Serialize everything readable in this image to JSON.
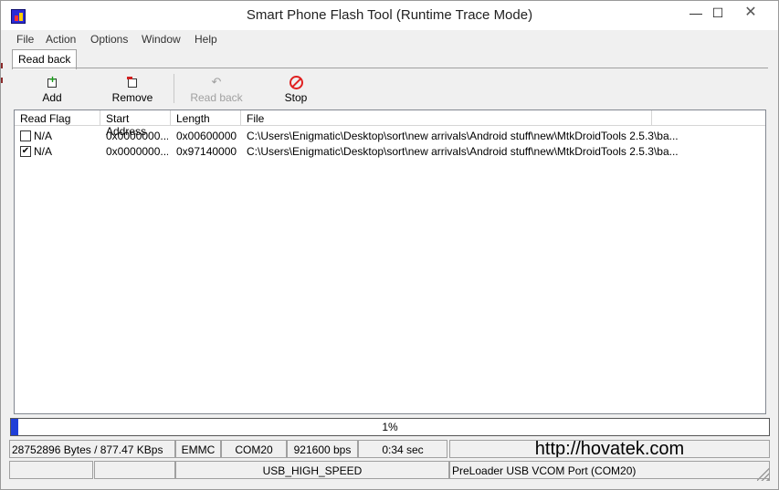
{
  "window": {
    "title": "Smart Phone Flash Tool (Runtime Trace Mode)",
    "controls": {
      "minimize": "—",
      "maximize": "☐",
      "close": "✕"
    }
  },
  "menu": [
    "File",
    "Action",
    "Options",
    "Window",
    "Help"
  ],
  "tabs": [
    {
      "label": "Read back",
      "active": true
    }
  ],
  "toolbar": {
    "add": {
      "label": "Add",
      "icon": "add-icon",
      "enabled": true
    },
    "remove": {
      "label": "Remove",
      "icon": "remove-icon",
      "enabled": true
    },
    "readback": {
      "label": "Read back",
      "icon": "undo-arrow-icon",
      "enabled": false
    },
    "stop": {
      "label": "Stop",
      "icon": "stop-icon",
      "enabled": true
    }
  },
  "list": {
    "columns": [
      "Read Flag",
      "Start Address",
      "Length",
      "File"
    ],
    "rows": [
      {
        "checked": false,
        "flag": "N/A",
        "start": "0x0000000...",
        "length": "0x00600000",
        "file": "C:\\Users\\Enigmatic\\Desktop\\sort\\new arrivals\\Android stuff\\new\\MtkDroidTools 2.5.3\\ba..."
      },
      {
        "checked": true,
        "flag": "N/A",
        "start": "0x0000000...",
        "length": "0x97140000",
        "file": "C:\\Users\\Enigmatic\\Desktop\\sort\\new arrivals\\Android stuff\\new\\MtkDroidTools 2.5.3\\ba..."
      }
    ]
  },
  "progress": {
    "percent": 1,
    "label": "1%",
    "color": "#1f3fd8"
  },
  "status": {
    "row1": {
      "bytes": "28752896 Bytes / 877.47 KBps",
      "storage": "EMMC",
      "port": "COM20",
      "baud": "921600 bps",
      "time": "0:34 sec",
      "watermark": "http://hovatek.com"
    },
    "row2": {
      "blank1": "",
      "blank2": "",
      "speed": "USB_HIGH_SPEED",
      "device": "PreLoader USB VCOM Port (COM20)"
    }
  }
}
